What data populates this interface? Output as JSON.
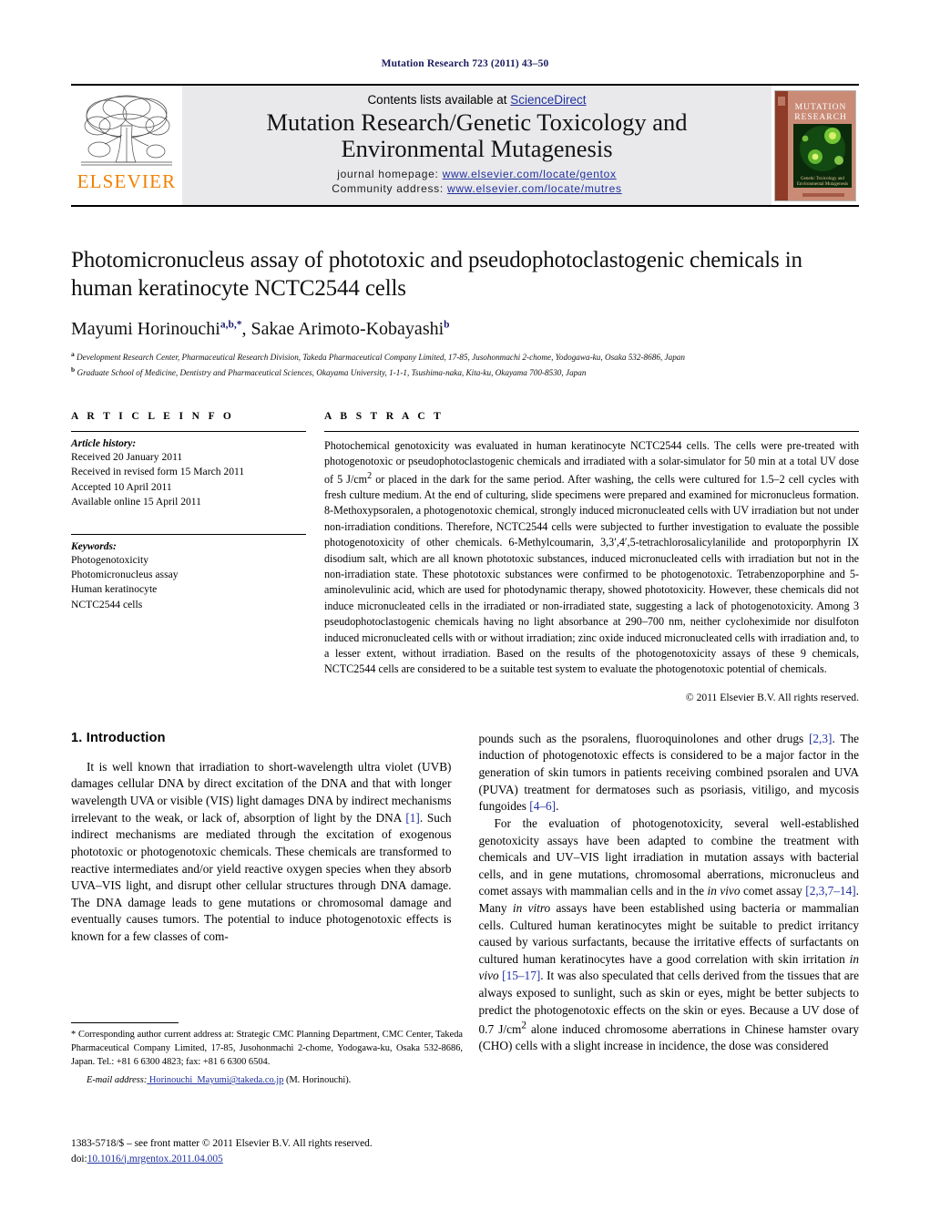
{
  "running_head": "Mutation Research 723 (2011) 43–50",
  "header": {
    "contents_prefix": "Contents lists available at ",
    "sciencedirect": "ScienceDirect",
    "journal_title_line1": "Mutation Research/Genetic Toxicology and",
    "journal_title_line2": "Environmental Mutagenesis",
    "homepage_label": "journal homepage:",
    "homepage_url": "www.elsevier.com/locate/gentox",
    "community_label": "Community address:",
    "community_url": "www.elsevier.com/locate/mutres",
    "publisher_logo_text": "ELSEVIER",
    "cover_title_line1": "MUTATION",
    "cover_title_line2": "RESEARCH",
    "cover_subtitle": "Genetic Toxicology and Environmental Mutagenesis",
    "accent_orange": "#F08000",
    "link_blue": "#2030a0",
    "band_gray": "#e9e9eb"
  },
  "article": {
    "title": "Photomicronucleus assay of phototoxic and pseudophotoclastogenic chemicals in human keratinocyte NCTC2544 cells",
    "authors": "Mayumi Horinouchi, Sakae Arimoto-Kobayashi",
    "author1_name": "Mayumi Horinouchi",
    "author1_marks": "a,b,*",
    "author2_name": ", Sakae Arimoto-Kobayashi",
    "author2_marks": "b",
    "affiliation_a_mark": "a",
    "affiliation_a": " Development Research Center, Pharmaceutical Research Division, Takeda Pharmaceutical Company Limited, 17-85, Jusohonmachi 2-chome, Yodogawa-ku, Osaka 532-8686, Japan",
    "affiliation_b_mark": "b",
    "affiliation_b": " Graduate School of Medicine, Dentistry and Pharmaceutical Sciences, Okayama University, 1-1-1, Tsushima-naka, Kita-ku, Okayama 700-8530, Japan"
  },
  "article_info": {
    "heading": "A R T I C L E   I N F O",
    "history_label": "Article history:",
    "history": [
      "Received 20 January 2011",
      "Received in revised form 15 March 2011",
      "Accepted 10 April 2011",
      "Available online 15 April 2011"
    ],
    "keywords_label": "Keywords:",
    "keywords": [
      "Photogenotoxicity",
      "Photomicronucleus assay",
      "Human keratinocyte",
      "NCTC2544 cells"
    ]
  },
  "abstract": {
    "heading": "A B S T R A C T",
    "text": "Photochemical genotoxicity was evaluated in human keratinocyte NCTC2544 cells. The cells were pre-treated with photogenotoxic or pseudophotoclastogenic chemicals and irradiated with a solar-simulator for 50 min at a total UV dose of 5 J/cm2 or placed in the dark for the same period. After washing, the cells were cultured for 1.5–2 cell cycles with fresh culture medium. At the end of culturing, slide specimens were prepared and examined for micronucleus formation. 8-Methoxypsoralen, a photogenotoxic chemical, strongly induced micronucleated cells with UV irradiation but not under non-irradiation conditions. Therefore, NCTC2544 cells were subjected to further investigation to evaluate the possible photogenotoxicity of other chemicals. 6-Methylcoumarin, 3,3′,4′,5-tetrachlorosalicylanilide and protoporphyrin IX disodium salt, which are all known phototoxic substances, induced micronucleated cells with irradiation but not in the non-irradiation state. These phototoxic substances were confirmed to be photogenotoxic. Tetrabenzoporphine and 5-aminolevulinic acid, which are used for photodynamic therapy, showed phototoxicity. However, these chemicals did not induce micronucleated cells in the irradiated or non-irradiated state, suggesting a lack of photogenotoxicity. Among 3 pseudophotoclastogenic chemicals having no light absorbance at 290–700 nm, neither cycloheximide nor disulfoton induced micronucleated cells with or without irradiation; zinc oxide induced micronucleated cells with irradiation and, to a lesser extent, without irradiation. Based on the results of the photogenotoxicity assays of these 9 chemicals, NCTC2544 cells are considered to be a suitable test system to evaluate the photogenotoxic potential of chemicals.",
    "copyright": "© 2011 Elsevier B.V. All rights reserved."
  },
  "body": {
    "section_number_title": "1.  Introduction",
    "left_para1_a": "It is well known that irradiation to short-wavelength ultra violet (UVB) damages cellular DNA by direct excitation of the DNA and that with longer wavelength UVA or visible (VIS) light damages DNA by indirect mechanisms irrelevant to the weak, or lack of, absorption of light by the DNA ",
    "left_para1_ref1": "[1]",
    "left_para1_b": ". Such indirect mechanisms are mediated through the excitation of exogenous phototoxic or photogenotoxic chemicals. These chemicals are transformed to reactive intermediates and/or yield reactive oxygen species when they absorb UVA–VIS light, and disrupt other cellular structures through DNA damage. The DNA damage leads to gene mutations or chromosomal damage and eventually causes tumors. The potential to induce photogenotoxic effects is known for a few classes of com-",
    "right_para1_a": "pounds such as the psoralens, fluoroquinolones and other drugs ",
    "right_para1_ref1": "[2,3]",
    "right_para1_b": ". The induction of photogenotoxic effects is considered to be a major factor in the generation of skin tumors in patients receiving combined psoralen and UVA (PUVA) treatment for dermatoses such as psoriasis, vitiligo, and mycosis fungoides ",
    "right_para1_ref2": "[4–6]",
    "right_para1_c": ".",
    "right_para2_a": "For the evaluation of photogenotoxicity, several well-established genotoxicity assays have been adapted to combine the treatment with chemicals and UV–VIS light irradiation in mutation assays with bacterial cells, and in gene mutations, chromosomal aberrations, micronucleus and comet assays with mammalian cells and in the ",
    "right_para2_ital1": "in vivo",
    "right_para2_b": " comet assay ",
    "right_para2_ref1": "[2,3,7–14]",
    "right_para2_c": ". Many ",
    "right_para2_ital2": "in vitro",
    "right_para2_d": " assays have been established using bacteria or mammalian cells. Cultured human keratinocytes might be suitable to predict irritancy caused by various surfactants, because the irritative effects of surfactants on cultured human keratinocytes have a good correlation with skin irritation ",
    "right_para2_ital3": "in vivo",
    "right_para2_e": " ",
    "right_para2_ref2": "[15–17]",
    "right_para2_f": ". It was also speculated that cells derived from the tissues that are always exposed to sunlight, such as skin or eyes, might be better subjects to predict the photogenotoxic effects on the skin or eyes. Because a UV dose of 0.7 J/cm2 alone induced chromosome aberrations in Chinese hamster ovary (CHO) cells with a slight increase in incidence, the dose was considered"
  },
  "footnote": {
    "star": "*",
    "text": " Corresponding author current address at: Strategic CMC Planning Department, CMC Center, Takeda Pharmaceutical Company Limited, 17-85, Jusohonmachi 2-chome, Yodogawa-ku, Osaka 532-8686, Japan. Tel.: +81 6 6300 4823; fax: +81 6 6300 6504.",
    "email_label": "E-mail address:",
    "email": " Horinouchi_Mayumi@takeda.co.jp",
    "email_suffix": " (M. Horinouchi)."
  },
  "issn": {
    "line1": "1383-5718/$ – see front matter © 2011 Elsevier B.V. All rights reserved.",
    "doi_label": "doi:",
    "doi_value": "10.1016/j.mrgentox.2011.04.005"
  }
}
